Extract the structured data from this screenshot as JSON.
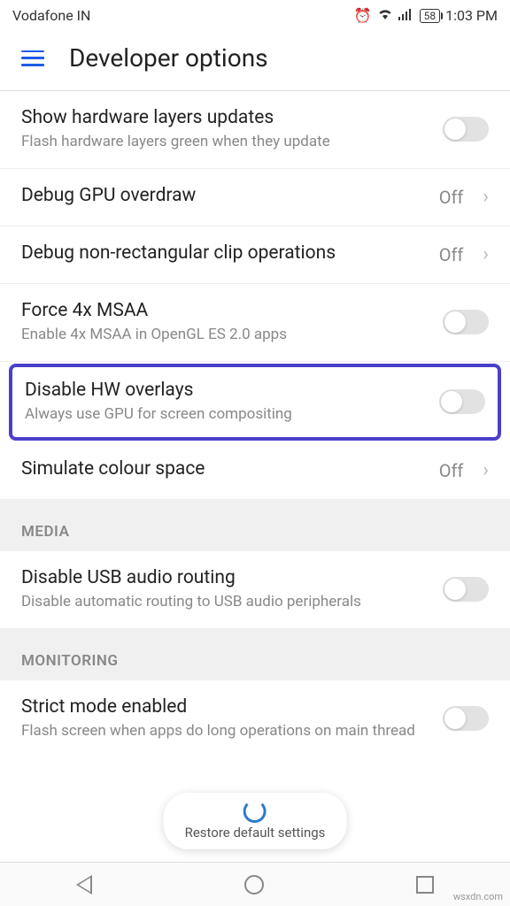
{
  "status": {
    "carrier": "Vodafone IN",
    "battery": "58",
    "time": "1:03 PM"
  },
  "header": {
    "title": "Developer options"
  },
  "items": {
    "hw_layers": {
      "title": "Show hardware layers updates",
      "subtitle": "Flash hardware layers green when they update"
    },
    "gpu_overdraw": {
      "title": "Debug GPU overdraw",
      "value": "Off"
    },
    "clip": {
      "title": "Debug non-rectangular clip operations",
      "value": "Off"
    },
    "msaa": {
      "title": "Force 4x MSAA",
      "subtitle": "Enable 4x MSAA in OpenGL ES 2.0 apps"
    },
    "hw_overlays": {
      "title": "Disable HW overlays",
      "subtitle": "Always use GPU for screen compositing"
    },
    "colour": {
      "title": "Simulate colour space",
      "value": "Off"
    },
    "usb_audio": {
      "title": "Disable USB audio routing",
      "subtitle": "Disable automatic routing to USB audio peripherals"
    },
    "strict": {
      "title": "Strict mode enabled",
      "subtitle": "Flash screen when apps do long operations on main thread"
    }
  },
  "sections": {
    "media": "MEDIA",
    "monitoring": "MONITORING"
  },
  "restore": "Restore default settings",
  "watermark": "wsxdn.com"
}
